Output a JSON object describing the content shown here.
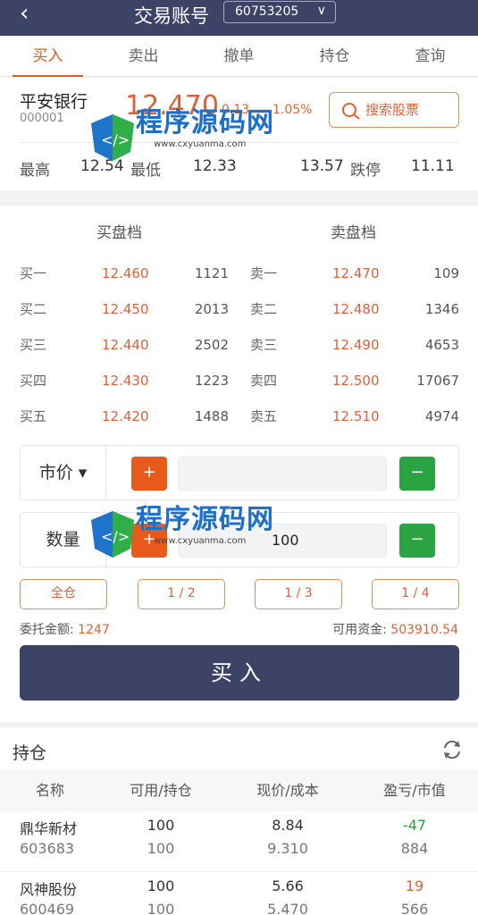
{
  "header": {
    "back": "‹",
    "title": "交易账号",
    "account": "60753205",
    "chevron": "∨"
  },
  "tabs": [
    "买入",
    "卖出",
    "撤单",
    "持仓",
    "查询"
  ],
  "stock": {
    "name": "平安银行",
    "code": "000001",
    "price": "12.470",
    "change": "0.13",
    "pct": "1.05%",
    "search_label": "搜索股票",
    "high_label": "最高",
    "high": "12.54",
    "low_label": "最低",
    "low": "12.33",
    "limit_up": "13.57",
    "limit_down_label": "跌停",
    "limit_down": "11.11"
  },
  "book": {
    "buy_title": "买盘档",
    "sell_title": "卖盘档",
    "buy": [
      {
        "label": "买一",
        "price": "12.460",
        "vol": "1121"
      },
      {
        "label": "买二",
        "price": "12.450",
        "vol": "2013"
      },
      {
        "label": "买三",
        "price": "12.440",
        "vol": "2502"
      },
      {
        "label": "买四",
        "price": "12.430",
        "vol": "1223"
      },
      {
        "label": "买五",
        "price": "12.420",
        "vol": "1488"
      }
    ],
    "sell": [
      {
        "label": "卖一",
        "price": "12.470",
        "vol": "109"
      },
      {
        "label": "卖二",
        "price": "12.480",
        "vol": "1346"
      },
      {
        "label": "卖三",
        "price": "12.490",
        "vol": "4653"
      },
      {
        "label": "卖四",
        "price": "12.500",
        "vol": "17067"
      },
      {
        "label": "卖五",
        "price": "12.510",
        "vol": "4974"
      }
    ]
  },
  "order": {
    "price_type": "市价 ▾",
    "qty_label": "数量",
    "qty_value": "100",
    "plus": "+",
    "minus": "−",
    "fractions": [
      "全仓",
      "1 / 2",
      "1 / 3",
      "1 / 4"
    ],
    "amount_label": "委托金额:",
    "amount": "1247",
    "avail_label": "可用资金:",
    "avail": "503910.54",
    "buy_label": "买入"
  },
  "holdings": {
    "title": "持仓",
    "columns": [
      "名称",
      "可用/持仓",
      "现价/成本",
      "盈亏/市值"
    ],
    "rows": [
      {
        "name": "鼎华新材",
        "code": "603683",
        "avail": "100",
        "hold": "100",
        "price": "8.84",
        "cost": "9.310",
        "pl": "-47",
        "value": "884"
      },
      {
        "name": "风神股份",
        "code": "600469",
        "avail": "100",
        "hold": "100",
        "price": "5.66",
        "cost": "5.470",
        "pl": "19",
        "value": "566"
      }
    ]
  },
  "watermark": {
    "text": "程序源码网",
    "sub": "www.cxyuanma.com"
  },
  "colors": {
    "navy": "#3d4366",
    "accent": "#e25c1e",
    "up": "#d9623a",
    "down": "#2e9e3e"
  }
}
